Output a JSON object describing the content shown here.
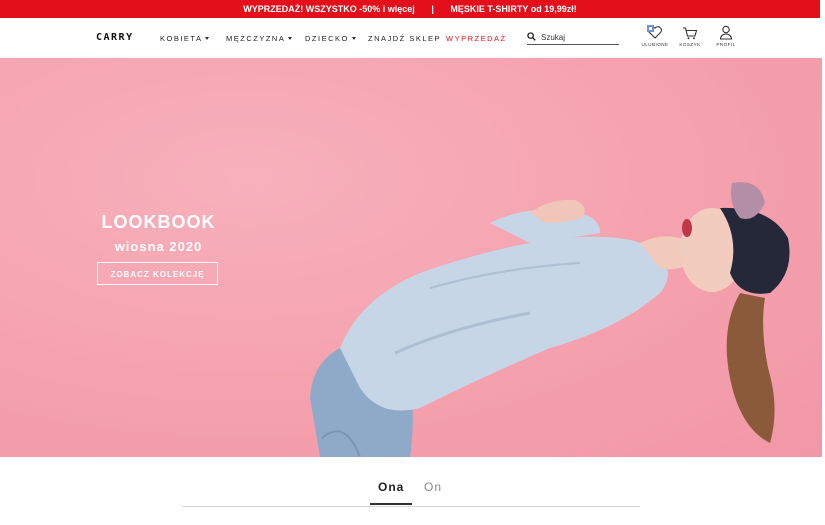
{
  "promo": {
    "left_text": "WYPRZEDAŻ! WSZYSTKO -50% i więcej",
    "separator": "|",
    "right_text": "MĘSKIE T-SHIRTY od 19,99zł!"
  },
  "header": {
    "logo": "CARRY",
    "nav": [
      {
        "label": "KOBIETA"
      },
      {
        "label": "MĘŻCZYZNA"
      },
      {
        "label": "DZIECKO"
      },
      {
        "label": "ZNAJDŹ SKLEP"
      },
      {
        "label": "WYPRZEDAŻ"
      }
    ],
    "search": {
      "placeholder": "Szukaj"
    },
    "icons": [
      {
        "name": "heart-icon",
        "label": "ULUBIONE"
      },
      {
        "name": "cart-icon",
        "label": "KOSZYK"
      },
      {
        "name": "user-icon",
        "label": "PROFIL"
      }
    ]
  },
  "hero": {
    "title": "LOOKBOOK",
    "subtitle": "wiosna 2020",
    "cta": "ZOBACZ KOLEKCJĘ"
  },
  "tabs": {
    "items": [
      {
        "label": "Ona",
        "active": true
      },
      {
        "label": "On",
        "active": false
      }
    ]
  },
  "colors": {
    "accent": "#e3101b",
    "hero_background": "#f5a0ad"
  }
}
